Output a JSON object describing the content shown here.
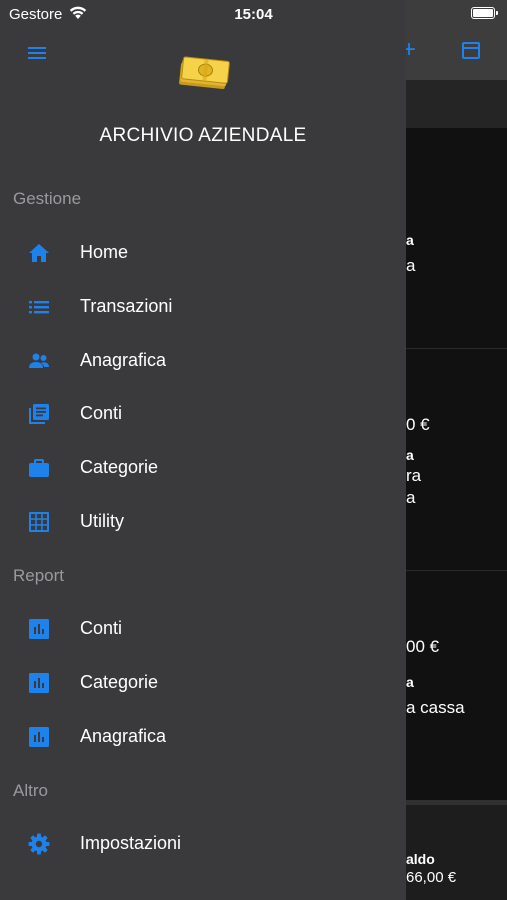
{
  "status_bar": {
    "carrier": "Gestore",
    "time": "15:04"
  },
  "drawer": {
    "title": "ARCHIVIO AZIENDALE",
    "sections": {
      "gestione": "Gestione",
      "report": "Report",
      "altro": "Altro"
    },
    "items": {
      "home": "Home",
      "transazioni": "Transazioni",
      "anagrafica": "Anagrafica",
      "conti": "Conti",
      "categorie": "Categorie",
      "utility": "Utility",
      "report_conti": "Conti",
      "report_categorie": "Categorie",
      "report_anagrafica": "Anagrafica",
      "impostazioni": "Impostazioni"
    }
  },
  "background": {
    "row1_line1": "a",
    "row1_line2": "a",
    "row2_amount": "0 €",
    "row2_line1": "a",
    "row2_line2": "ra",
    "row2_line3": "a",
    "row3_amount": "00 €",
    "row3_line1": "a",
    "row3_line2": "a cassa",
    "footer_label": "aldo",
    "footer_amount": "66,00 €"
  },
  "colors": {
    "accent": "#1e82ea",
    "drawer_bg": "#3a3a3c",
    "section_text": "#9a9a9e"
  }
}
